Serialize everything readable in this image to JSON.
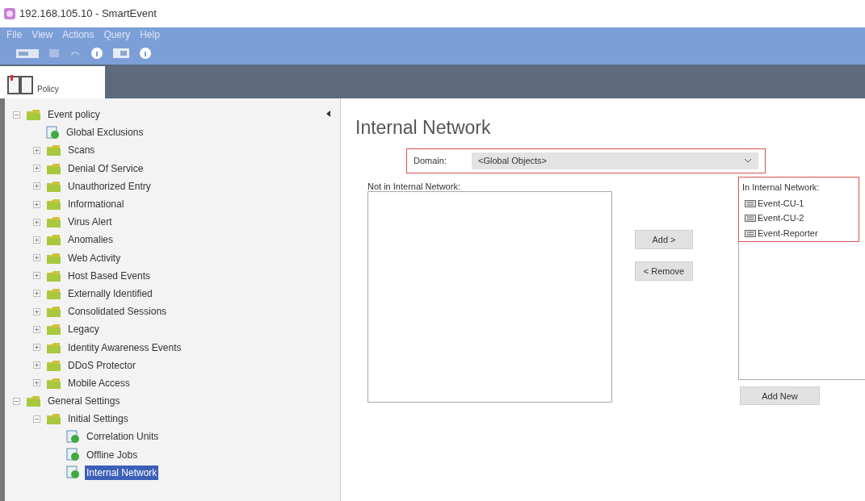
{
  "window": {
    "title": "192.168.105.10 - SmartEvent"
  },
  "menu": [
    "File",
    "View",
    "Actions",
    "Query",
    "Help"
  ],
  "tabs": [
    {
      "label": "Policy",
      "selected": true
    }
  ],
  "tree": [
    {
      "label": "Event policy",
      "kind": "folder",
      "expanded": true,
      "selected": false,
      "children": [
        {
          "label": "Global Exclusions",
          "kind": "page",
          "selected": false
        },
        {
          "label": "Scans",
          "kind": "folder",
          "expanded": false,
          "selected": false
        },
        {
          "label": "Denial Of Service",
          "kind": "folder",
          "expanded": false,
          "selected": false
        },
        {
          "label": "Unauthorized Entry",
          "kind": "folder",
          "expanded": false,
          "selected": false
        },
        {
          "label": "Informational",
          "kind": "folder",
          "expanded": false,
          "selected": false
        },
        {
          "label": "Virus Alert",
          "kind": "folder",
          "expanded": false,
          "selected": false
        },
        {
          "label": "Anomalies",
          "kind": "folder",
          "expanded": false,
          "selected": false
        },
        {
          "label": "Web Activity",
          "kind": "folder",
          "expanded": false,
          "selected": false
        },
        {
          "label": "Host Based Events",
          "kind": "folder",
          "expanded": false,
          "selected": false
        },
        {
          "label": "Externally Identified",
          "kind": "folder",
          "expanded": false,
          "selected": false
        },
        {
          "label": "Consolidated Sessions",
          "kind": "folder",
          "expanded": false,
          "selected": false
        },
        {
          "label": "Legacy",
          "kind": "folder",
          "expanded": false,
          "selected": false
        },
        {
          "label": "Identity Awareness Events",
          "kind": "folder",
          "expanded": false,
          "selected": false
        },
        {
          "label": "DDoS Protector",
          "kind": "folder",
          "expanded": false,
          "selected": false
        },
        {
          "label": "Mobile Access",
          "kind": "folder",
          "expanded": false,
          "selected": false
        }
      ]
    },
    {
      "label": "General Settings",
      "kind": "folder",
      "expanded": true,
      "selected": false,
      "children": [
        {
          "label": "Initial Settings",
          "kind": "folder",
          "expanded": true,
          "selected": false,
          "children": [
            {
              "label": "Correlation Units",
              "kind": "page",
              "selected": false
            },
            {
              "label": "Offline Jobs",
              "kind": "page",
              "selected": false
            },
            {
              "label": "Internal Network",
              "kind": "page",
              "selected": true
            }
          ]
        }
      ]
    }
  ],
  "page": {
    "title": "Internal Network",
    "domain": {
      "label": "Domain:",
      "value": "<Global Objects>",
      "highlighted": true
    },
    "not_in_network": {
      "label": "Not in Internal Network:"
    },
    "add_button": "Add >",
    "remove_button": "< Remove",
    "in_network": {
      "label": "In Internal Network:",
      "highlighted": true,
      "items": [
        "Event-CU-1",
        "Event-CU-2",
        "Event-Reporter"
      ]
    },
    "add_new_button": "Add New"
  }
}
